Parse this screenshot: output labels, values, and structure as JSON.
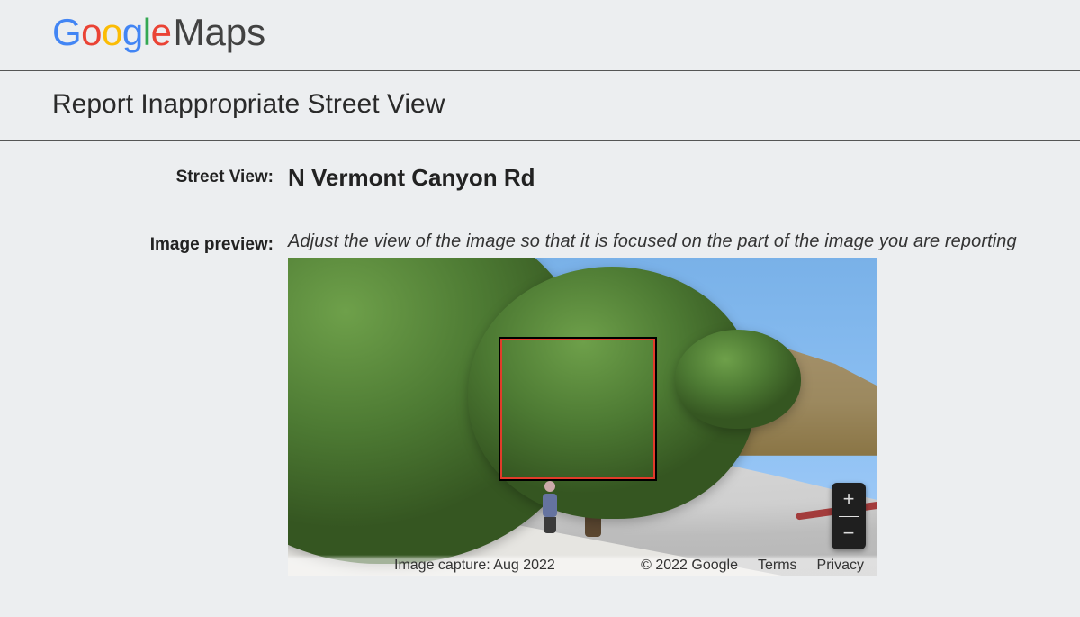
{
  "logo": {
    "maps_label": "Maps"
  },
  "page_title": "Report Inappropriate Street View",
  "rows": {
    "street_view": {
      "label": "Street View:",
      "value": "N Vermont Canyon Rd"
    },
    "image_preview": {
      "label": "Image preview:",
      "hint": "Adjust the view of the image so that it is focused on the part of the image you are reporting"
    }
  },
  "preview": {
    "zoom_in": "+",
    "zoom_out": "−",
    "attribution": {
      "capture": "Image capture: Aug 2022",
      "copyright": "© 2022 Google",
      "terms": "Terms",
      "privacy": "Privacy"
    }
  }
}
